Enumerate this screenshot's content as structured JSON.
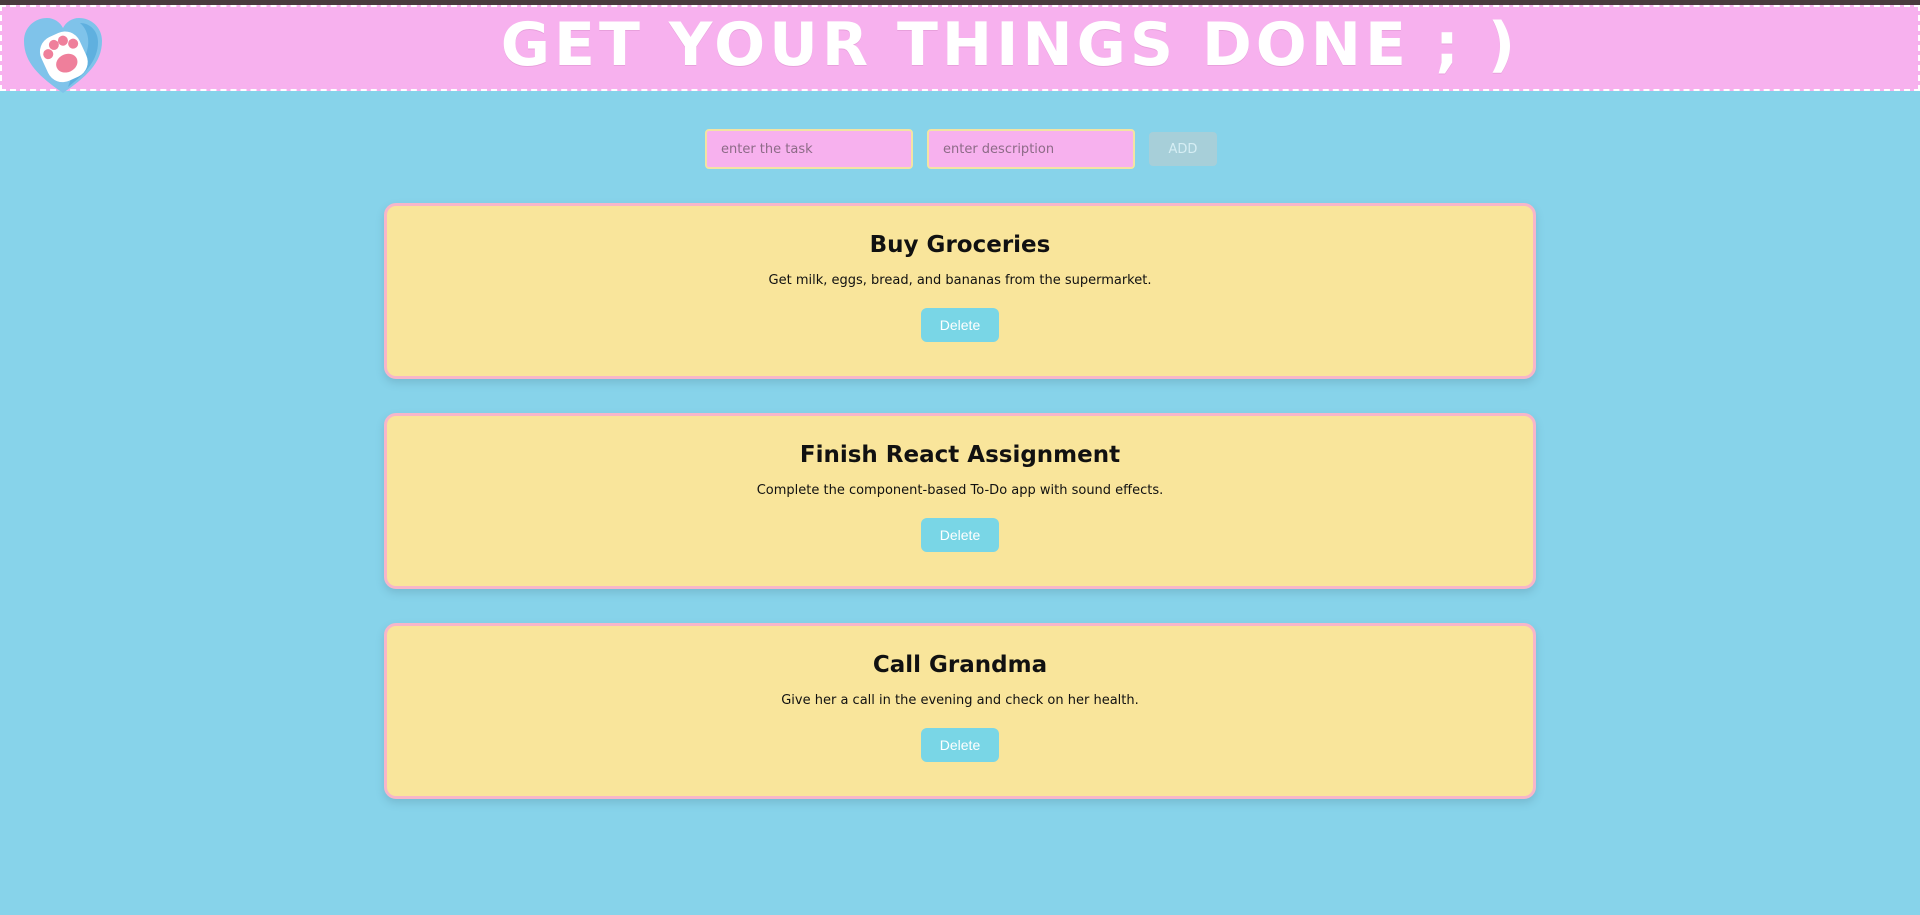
{
  "header": {
    "title": "GET YOUR THINGS DONE ; )",
    "logo_icon": "heart-paw-icon"
  },
  "form": {
    "task_placeholder": "enter the task",
    "task_value": "",
    "description_placeholder": "enter description",
    "description_value": "",
    "add_label": "ADD"
  },
  "tasks": [
    {
      "title": "Buy Groceries",
      "description": "Get milk, eggs, bread, and bananas from the supermarket.",
      "delete_label": "Delete"
    },
    {
      "title": "Finish React Assignment",
      "description": "Complete the component-based To-Do app with sound effects.",
      "delete_label": "Delete"
    },
    {
      "title": "Call Grandma",
      "description": "Give her a call in the evening and check on her health.",
      "delete_label": "Delete"
    }
  ],
  "colors": {
    "background": "#87d3ea",
    "header": "#f7b1ee",
    "card": "#f9e59b",
    "card_border": "#f7b6c9",
    "delete_button": "#79d6e6",
    "add_button_disabled": "#a7cfd9"
  }
}
